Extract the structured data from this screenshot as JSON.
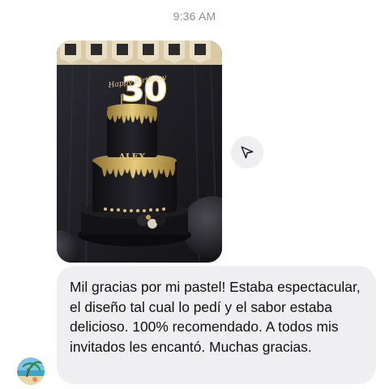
{
  "header": {
    "timestamp": "9:36 AM"
  },
  "photo_message": {
    "cake_topper_number": "30",
    "cake_topper_script": "Happy Birthday",
    "cake_name_plate": "ALEX"
  },
  "text_message": {
    "body": "Mil gracias por mi pastel! Estaba espectacular, el diseño tal cual lo pedí y el sabor estaba delicioso. 100% recomendado. A todos mis invitados les encantó. Muchas gracias."
  },
  "icons": {
    "share": "paper-plane-icon",
    "avatar": "beach-avatar"
  },
  "colors": {
    "bubble_bg": "#efeff1",
    "timestamp": "#8e8e93",
    "gold": "#c9a646"
  }
}
